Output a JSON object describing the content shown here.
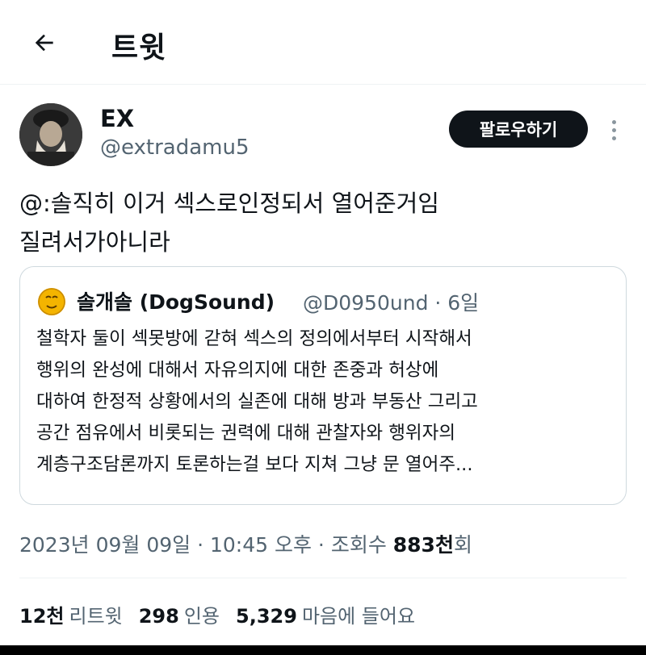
{
  "header": {
    "title": "트윗"
  },
  "author": {
    "name": "EX",
    "handle": "@extradamu5"
  },
  "follow_label": "팔로우하기",
  "tweet": {
    "line1": "@:솔직히 이거 섹스로인정되서 열어준거임",
    "line2": "질려서가아니라"
  },
  "quote": {
    "name": "솔개솔 (DogSound)",
    "meta": "@D0950und · 6일",
    "lines": [
      "철학자 둘이 섹못방에 갇혀 섹스의 정의에서부터 시작해서",
      "행위의 완성에 대해서 자유의지에 대한 존중과 허상에",
      "대하여 한정적 상황에서의 실존에 대해 방과 부동산 그리고",
      "공간 점유에서 비롯되는 권력에 대해 관찰자와 행위자의",
      "계층구조담론까지 토론하는걸 보다 지쳐 그냥 문 열어주..."
    ]
  },
  "timestamp": {
    "text": "2023년 09월 09일 · 10:45 오후 · 조회수 ",
    "views": "883천",
    "suffix": "회"
  },
  "stats": {
    "retweets": {
      "num": "12천",
      "label": "리트윗"
    },
    "quotes": {
      "num": "298",
      "label": "인용"
    },
    "likes": {
      "num": "5,329",
      "label": "마음에 들어요"
    }
  },
  "colors": {
    "text": "#0f1419",
    "secondary": "#536471",
    "border": "#cfd9de"
  }
}
